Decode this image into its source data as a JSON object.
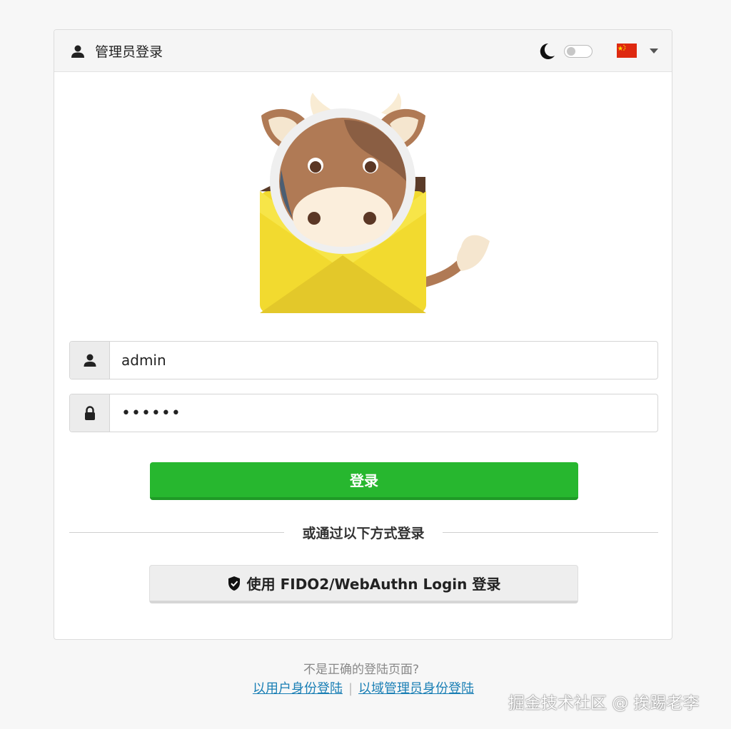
{
  "header": {
    "title": "管理员登录",
    "icons": {
      "user": "user-icon",
      "theme": "moon-icon",
      "language": "china-flag-icon",
      "dropdown": "caret-down-icon"
    },
    "dark_mode_enabled": false
  },
  "logo": {
    "icon": "mailcow-logo"
  },
  "form": {
    "username": {
      "value": "admin",
      "icon": "user-icon"
    },
    "password": {
      "value": "••••••",
      "icon": "lock-icon"
    },
    "login_label": "登录"
  },
  "alt_login": {
    "divider_text": "或通过以下方式登录",
    "fido_label": "使用 FIDO2/WebAuthn Login 登录",
    "fido_icon": "shield-icon"
  },
  "footer": {
    "question": "不是正确的登陆页面?",
    "user_login_link": "以用户身份登陆",
    "separator": "|",
    "domain_admin_link": "以域管理员身份登陆"
  },
  "watermark": "掘金技术社区 @ 挨踢老李",
  "colors": {
    "primary_green": "#27b72f",
    "link": "#1a7fb5",
    "background": "#f7f7f7"
  }
}
